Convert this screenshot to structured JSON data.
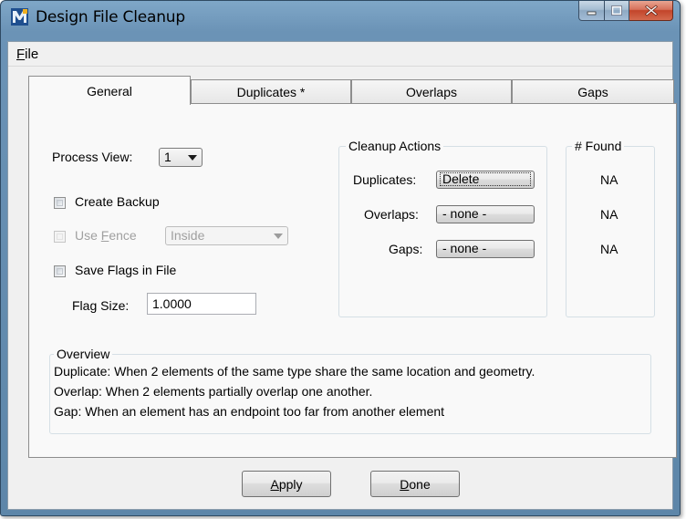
{
  "window": {
    "title": "Design File Cleanup",
    "icon": "microstation-app-icon",
    "caption_buttons": [
      "minimize-icon",
      "maximize-icon",
      "close-icon"
    ]
  },
  "menu": {
    "file": "File"
  },
  "tabs": [
    {
      "label": "General",
      "active": true
    },
    {
      "label": "Duplicates *",
      "active": false
    },
    {
      "label": "Overlaps",
      "active": false
    },
    {
      "label": "Gaps",
      "active": false
    }
  ],
  "general": {
    "process_view_label": "Process View:",
    "process_view_value": "1",
    "create_backup_label": "Create Backup",
    "use_fence_label_pre": "Use ",
    "use_fence_label_key": "F",
    "use_fence_label_post": "ence",
    "fence_mode_value": "Inside",
    "save_flags_label": "Save Flags in File",
    "flag_size_label": "Flag Size:",
    "flag_size_value": "1.0000"
  },
  "cleanup_actions": {
    "title": "Cleanup Actions",
    "duplicates_label": "Duplicates:",
    "duplicates_value": "Delete",
    "overlaps_label": "Overlaps:",
    "overlaps_value": "- none -",
    "gaps_label": "Gaps:",
    "gaps_value": "- none -"
  },
  "found": {
    "title": "# Found",
    "duplicates": "NA",
    "overlaps": "NA",
    "gaps": "NA"
  },
  "overview": {
    "title": "Overview",
    "lines": [
      "Duplicate: When 2 elements of the same type share the same location and geometry.",
      "Overlap: When 2 elements partially overlap one another.",
      "Gap: When an element has an endpoint too far from another element"
    ]
  },
  "buttons": {
    "apply": "Apply",
    "done": "Done"
  },
  "colors": {
    "titlebar": "#6b93b6",
    "close_button": "#c2442a",
    "dialog_bg": "#f0f0f0",
    "panel_bg": "#f9f9f9"
  }
}
